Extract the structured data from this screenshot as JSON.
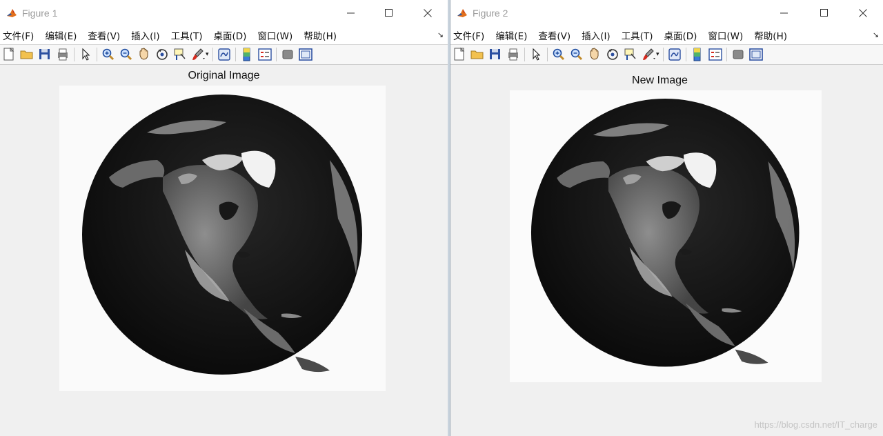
{
  "figure1": {
    "title": "Figure 1",
    "menu": [
      "文件(F)",
      "编辑(E)",
      "查看(V)",
      "插入(I)",
      "工具(T)",
      "桌面(D)",
      "窗口(W)",
      "帮助(H)"
    ],
    "plot_title": "Original Image"
  },
  "figure2": {
    "title": "Figure 2",
    "menu": [
      "文件(F)",
      "编辑(E)",
      "查看(V)",
      "插入(I)",
      "工具(T)",
      "桌面(D)",
      "窗口(W)",
      "帮助(H)"
    ],
    "plot_title": "New Image"
  },
  "toolbar_icons": [
    "new-figure-icon",
    "open-file-icon",
    "save-icon",
    "print-icon",
    "select-pointer-icon",
    "zoom-in-icon",
    "zoom-out-icon",
    "pan-hand-icon",
    "rotate-3d-icon",
    "data-cursor-icon",
    "brush-icon",
    "link-plot-icon",
    "colorbar-icon",
    "legend-icon",
    "hide-plot-tools-icon",
    "show-plot-tools-icon"
  ],
  "watermark": "https://blog.csdn.net/IT_charge",
  "colors": {
    "matlab_orange": "#e2701c",
    "matlab_blue": "#2d5da8",
    "globe_dark": "#1a1a1a"
  }
}
